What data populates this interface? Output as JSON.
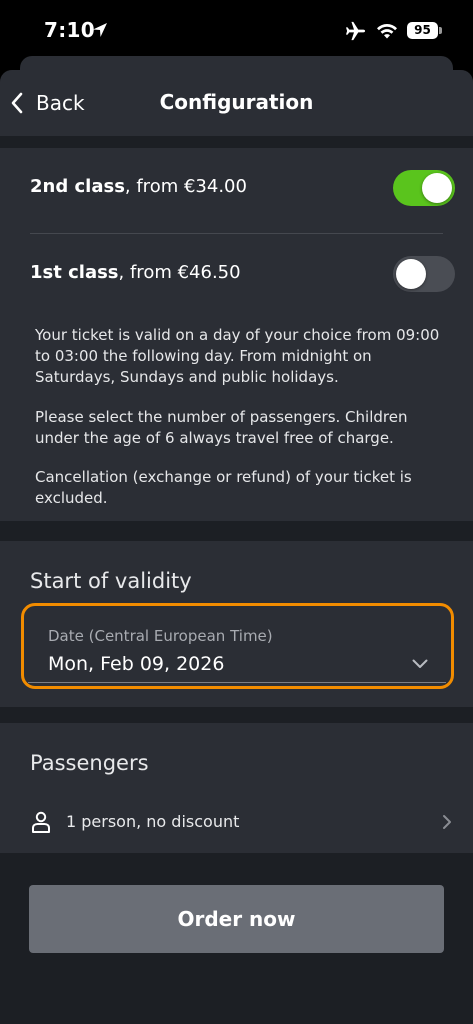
{
  "status_bar": {
    "time": "7:10",
    "battery": "95",
    "icons": [
      "location-arrow-icon",
      "airplane-icon",
      "wifi-icon",
      "battery-icon"
    ]
  },
  "nav": {
    "back_label": "Back",
    "title": "Configuration"
  },
  "classes": {
    "second": {
      "name": "2nd class",
      "price": ", from €34.00",
      "enabled": true
    },
    "first": {
      "name": "1st class",
      "price": ", from €46.50",
      "enabled": false
    }
  },
  "info": {
    "validity": "Your ticket is valid on a day of your choice from 09:00 to 03:00 the following day. From midnight on Saturdays, Sundays and public holidays.",
    "passengers": "Please select the number of passengers. Children under the age of 6 always travel free of charge.",
    "cancellation": "Cancellation (exchange or refund) of your ticket is excluded."
  },
  "validity": {
    "heading": "Start of validity",
    "date_label": "Date (Central European Time)",
    "date_value": "Mon, Feb 09, 2026"
  },
  "passengers": {
    "heading": "Passengers",
    "summary": "1 person, no discount"
  },
  "order_button": "Order now",
  "colors": {
    "background": "#000000",
    "sheet": "#1c1f24",
    "card": "#2b2e35",
    "toggle_on": "#5ac41d",
    "toggle_off": "#4a4d54",
    "highlight": "#f28c00",
    "button": "#6a6e76"
  }
}
